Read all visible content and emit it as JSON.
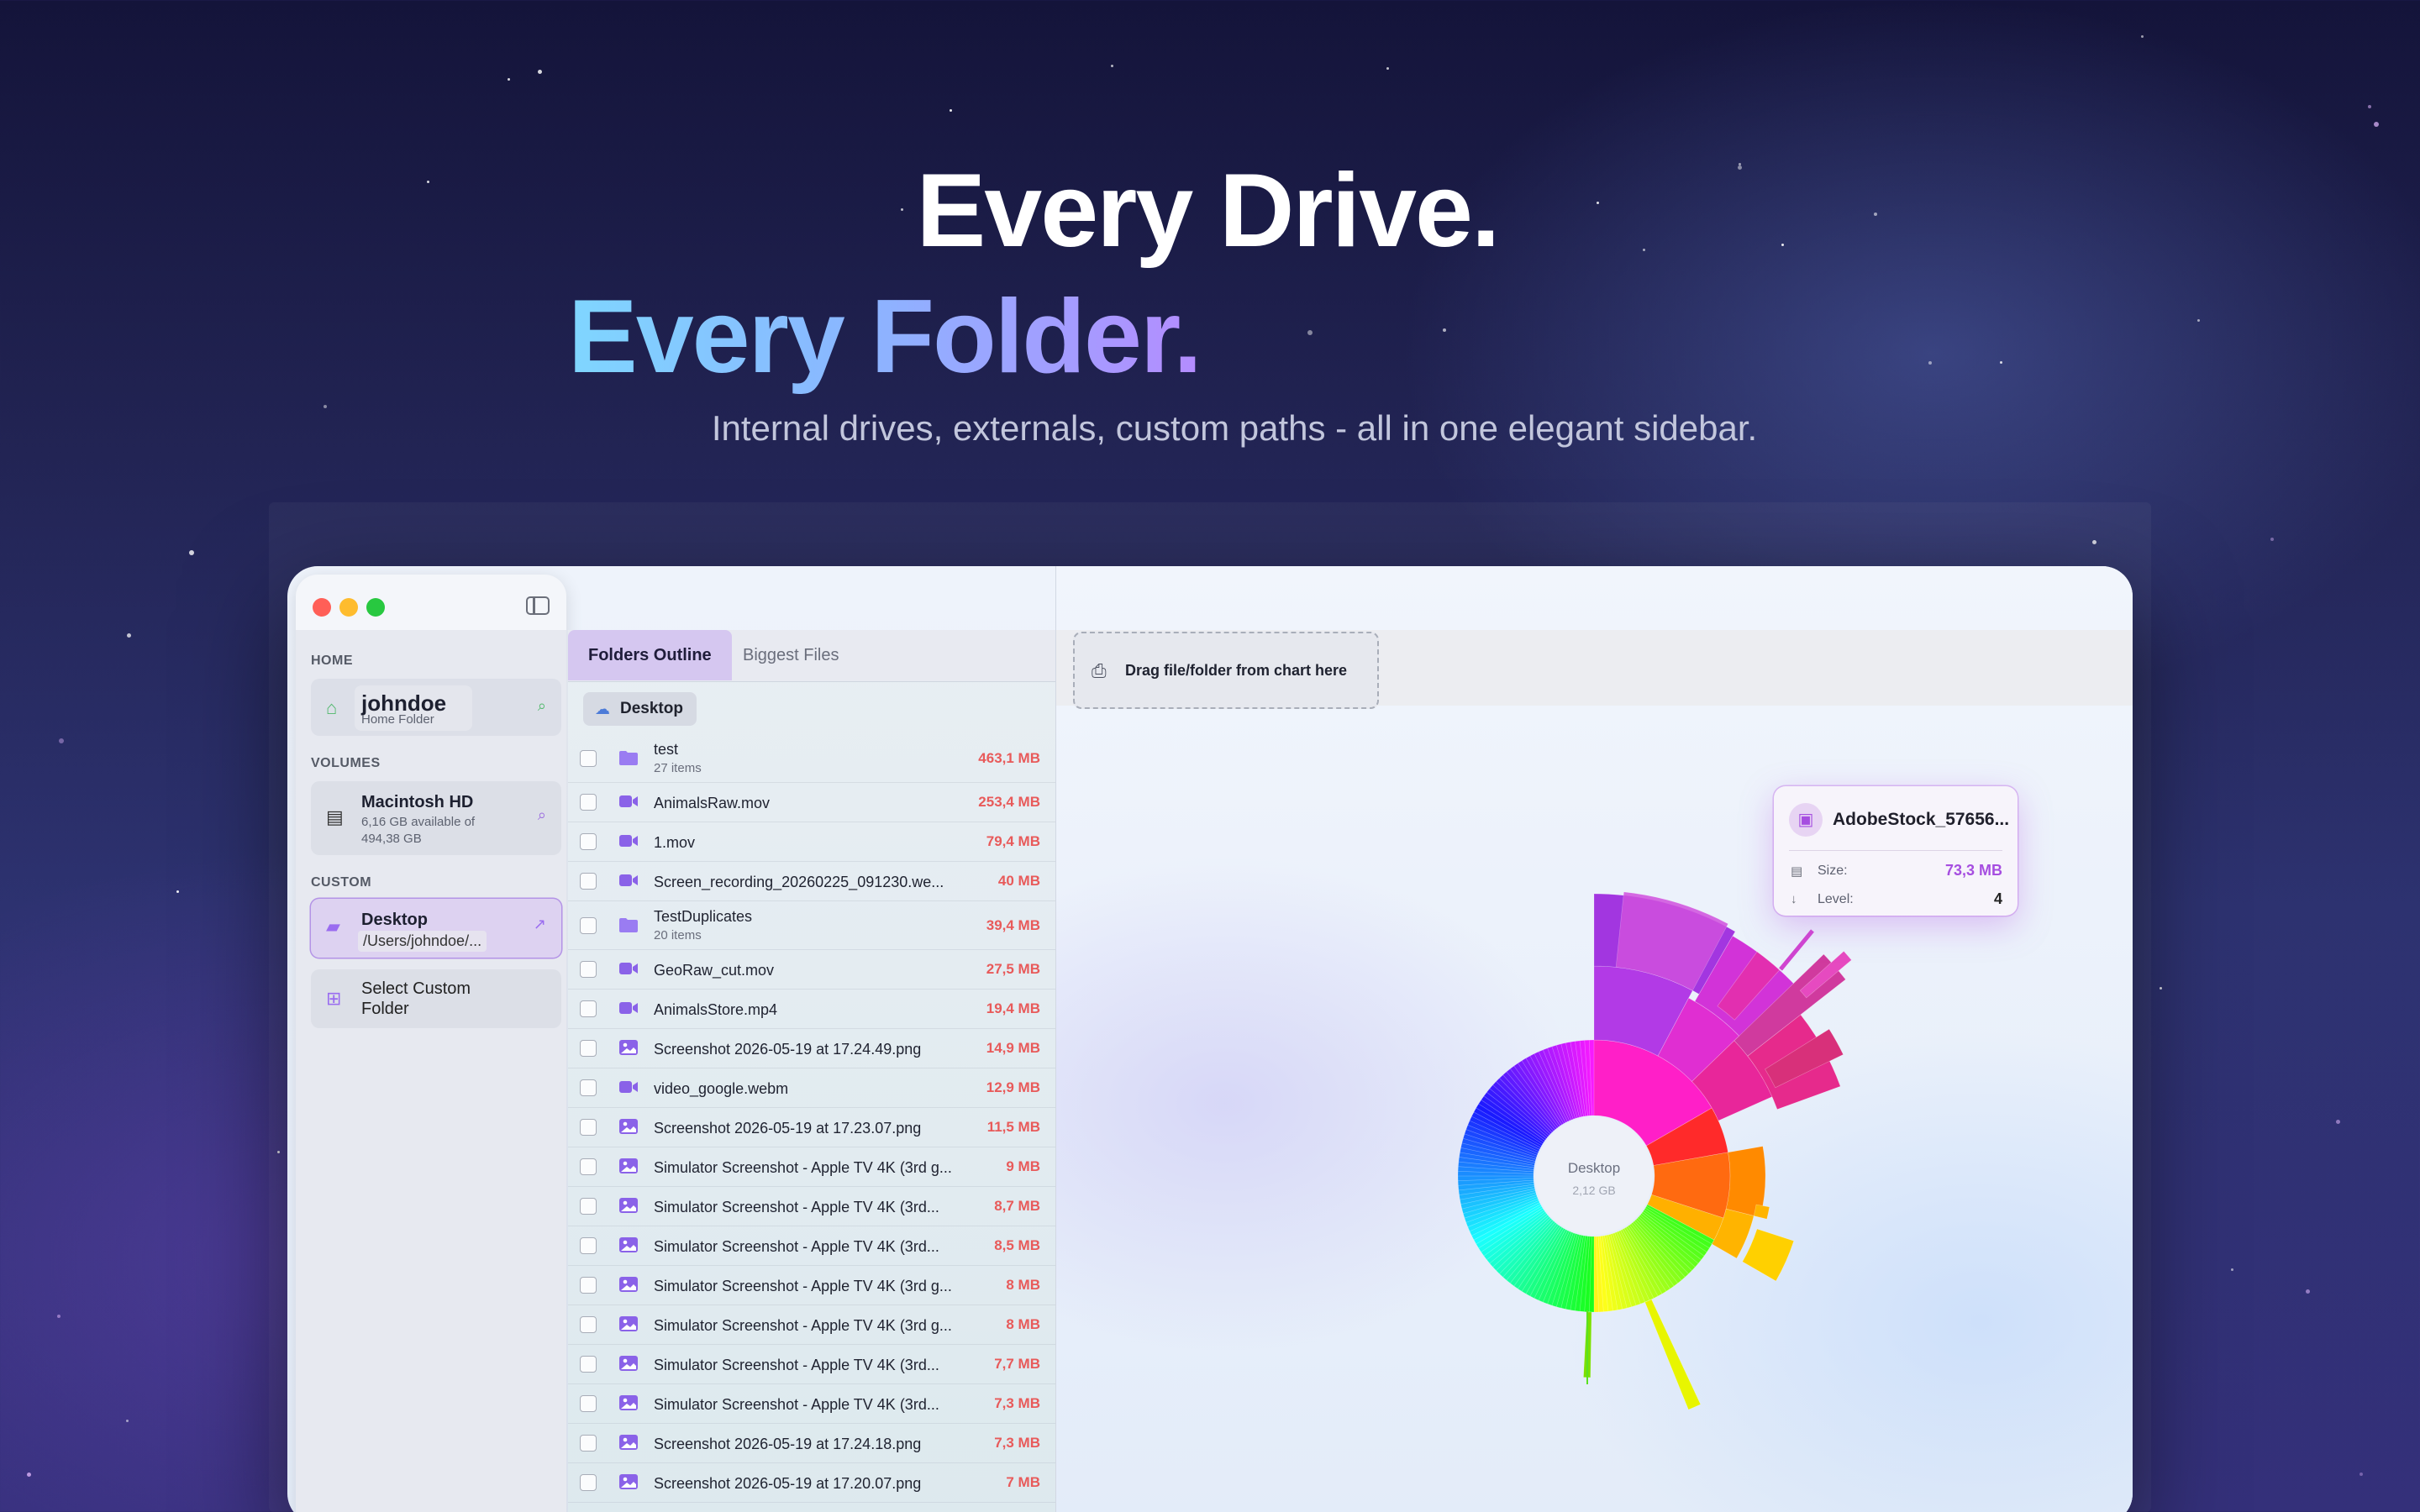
{
  "hero": {
    "line1": "Every Drive.",
    "line2": "Every Folder.",
    "subtitle": "Internal drives, externals, custom paths - all in one elegant sidebar."
  },
  "colors": {
    "accent": "#a64ee0",
    "size_red": "#e85a5a",
    "tab_active_bg": "#d5c7f0"
  },
  "sidebar": {
    "home_label": "HOME",
    "home": {
      "name": "johndoe",
      "sub": "Home Folder",
      "icon": "house-icon",
      "action": "search-icon"
    },
    "volumes_label": "VOLUMES",
    "volume": {
      "name": "Macintosh HD",
      "sub1": "6,16 GB available of",
      "sub2": "494,38 GB",
      "icon": "drive-icon",
      "action": "search-icon"
    },
    "custom_label": "CUSTOM",
    "custom": {
      "name": "Desktop",
      "path": "/Users/johndoe/...",
      "icon": "folder-icon",
      "action": "share-icon"
    },
    "select_custom": {
      "line1": "Select Custom",
      "line2": "Folder",
      "icon": "folder-add-icon"
    }
  },
  "list": {
    "tabs": [
      "Folders Outline",
      "Biggest Files"
    ],
    "breadcrumb": "Desktop",
    "items": [
      {
        "name": "test",
        "sub": "27 items",
        "size": "463,1 MB",
        "kind": "folder"
      },
      {
        "name": "AnimalsRaw.mov",
        "size": "253,4 MB",
        "kind": "video"
      },
      {
        "name": "1.mov",
        "size": "79,4 MB",
        "kind": "video"
      },
      {
        "name": "Screen_recording_20260225_091230.we...",
        "size": "40 MB",
        "kind": "video"
      },
      {
        "name": "TestDuplicates",
        "sub": "20 items",
        "size": "39,4 MB",
        "kind": "folder"
      },
      {
        "name": "GeoRaw_cut.mov",
        "size": "27,5 MB",
        "kind": "video"
      },
      {
        "name": "AnimalsStore.mp4",
        "size": "19,4 MB",
        "kind": "video"
      },
      {
        "name": "Screenshot 2026-05-19 at 17.24.49.png",
        "size": "14,9 MB",
        "kind": "image"
      },
      {
        "name": "video_google.webm",
        "size": "12,9 MB",
        "kind": "video"
      },
      {
        "name": "Screenshot 2026-05-19 at 17.23.07.png",
        "size": "11,5 MB",
        "kind": "image"
      },
      {
        "name": "Simulator Screenshot - Apple TV 4K (3rd g...",
        "size": "9 MB",
        "kind": "image"
      },
      {
        "name": "Simulator Screenshot - Apple TV 4K (3rd...",
        "size": "8,7 MB",
        "kind": "image"
      },
      {
        "name": "Simulator Screenshot - Apple TV 4K (3rd...",
        "size": "8,5 MB",
        "kind": "image"
      },
      {
        "name": "Simulator Screenshot - Apple TV 4K (3rd g...",
        "size": "8 MB",
        "kind": "image"
      },
      {
        "name": "Simulator Screenshot - Apple TV 4K (3rd g...",
        "size": "8 MB",
        "kind": "image"
      },
      {
        "name": "Simulator Screenshot - Apple TV 4K (3rd...",
        "size": "7,7 MB",
        "kind": "image"
      },
      {
        "name": "Simulator Screenshot - Apple TV 4K (3rd...",
        "size": "7,3 MB",
        "kind": "image"
      },
      {
        "name": "Screenshot 2026-05-19 at 17.24.18.png",
        "size": "7,3 MB",
        "kind": "image"
      },
      {
        "name": "Screenshot 2026-05-19 at 17.20.07.png",
        "size": "7 MB",
        "kind": "image"
      }
    ]
  },
  "main": {
    "drop_label": "Drag file/folder from chart here",
    "chart_center_name": "Desktop",
    "chart_center_size": "2,12 GB",
    "tooltip": {
      "title": "AdobeStock_57656...",
      "size_label": "Size:",
      "size_value": "73,3 MB",
      "level_label": "Level:",
      "level_value": "4"
    }
  }
}
